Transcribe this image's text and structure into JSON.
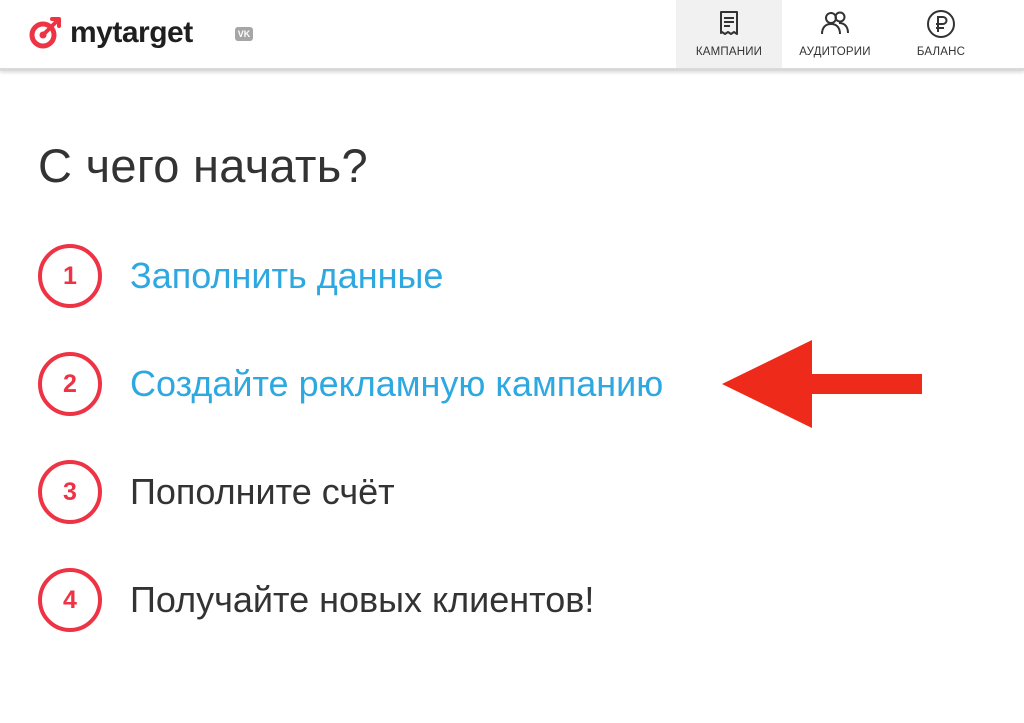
{
  "header": {
    "logo_text": "mytarget",
    "vk_badge": "VK",
    "nav": [
      {
        "label": "КАМПАНИИ",
        "icon": "campaigns-icon",
        "active": true
      },
      {
        "label": "АУДИТОРИИ",
        "icon": "audiences-icon",
        "active": false
      },
      {
        "label": "БАЛАНС",
        "icon": "ruble-icon",
        "active": false
      }
    ]
  },
  "main": {
    "title": "С чего начать?",
    "steps": [
      {
        "number": "1",
        "label": "Заполнить данные",
        "is_link": true
      },
      {
        "number": "2",
        "label": "Создайте рекламную кампанию",
        "is_link": true
      },
      {
        "number": "3",
        "label": "Пополните счёт",
        "is_link": false
      },
      {
        "number": "4",
        "label": "Получайте новых клиентов!",
        "is_link": false
      }
    ]
  },
  "colors": {
    "accent_red": "#ee3344",
    "link_blue": "#2ea8e0",
    "text_dark": "#333333",
    "arrow_red": "#ee2a1a"
  },
  "annotation": {
    "arrow_icon": "arrow-left-icon",
    "points_to_step": "2"
  }
}
